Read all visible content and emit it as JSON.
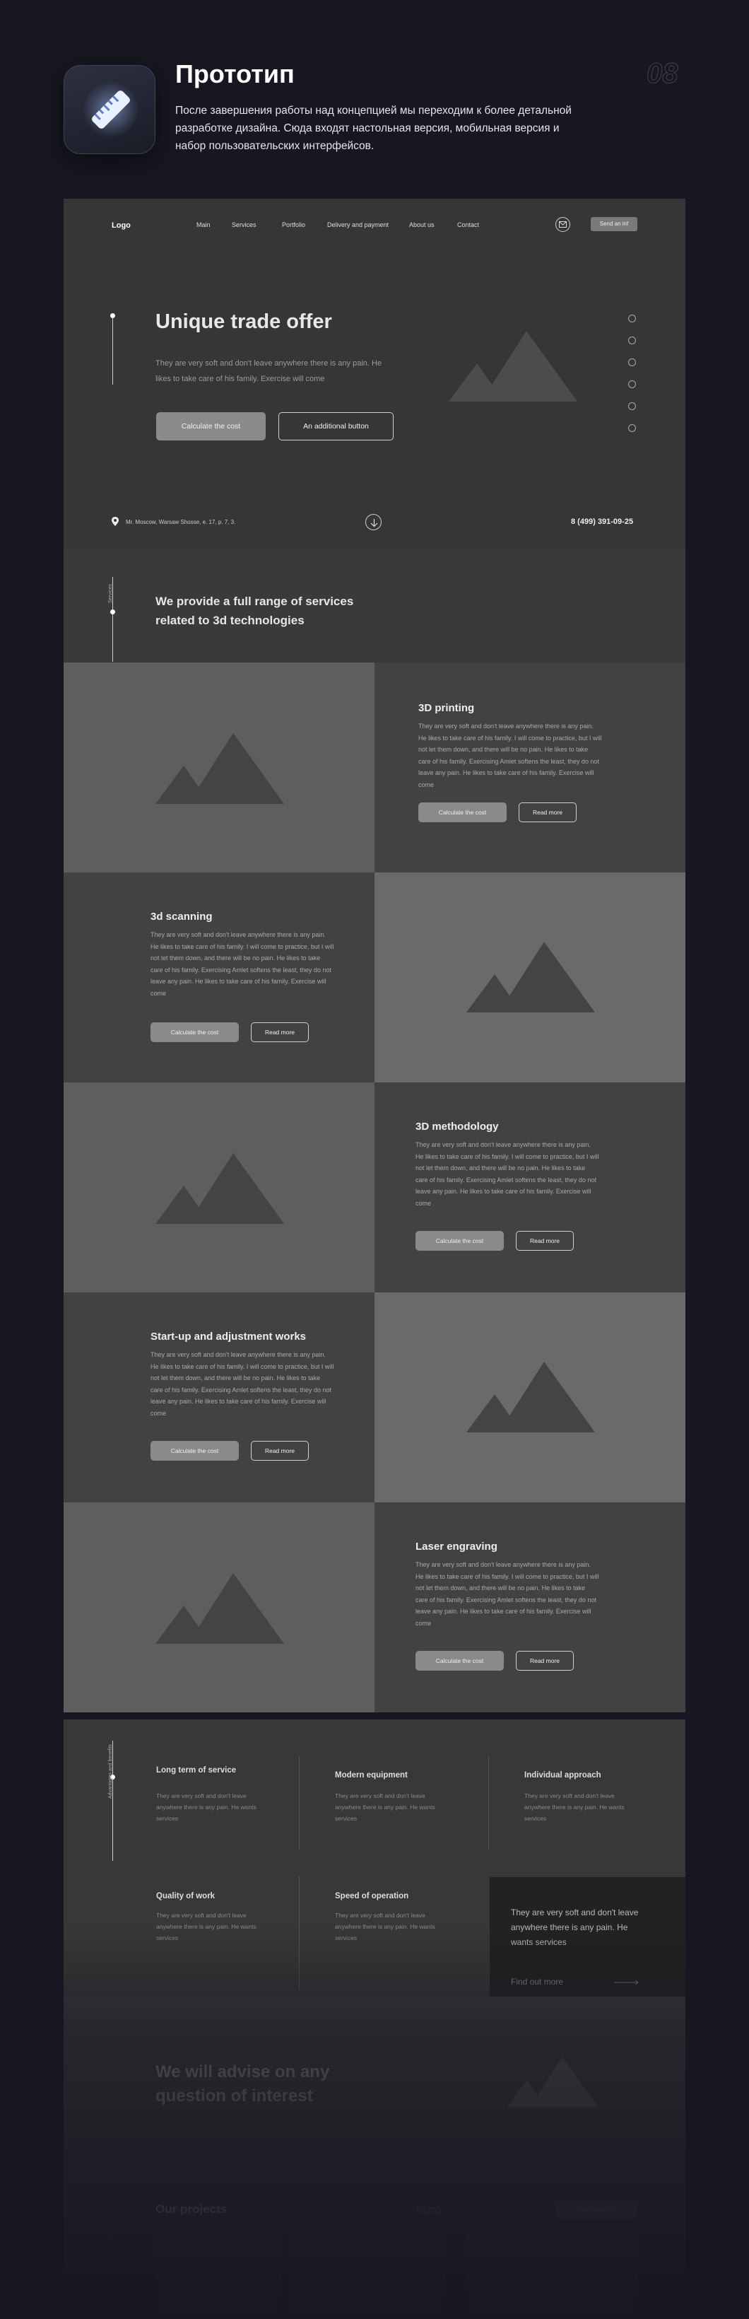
{
  "header": {
    "title": "Прототип",
    "description": "После завершения работы над концепцией мы переходим к более детальной разработке дизайна. Сюда входят настольная версия, мобильная версия и набор пользовательских интерфейсов.",
    "step_number": "08",
    "app_icon": "ruler-icon"
  },
  "mockup": {
    "nav": {
      "logo": "Logo",
      "items": [
        "Main",
        "Services",
        "Portfolio",
        "Delivery and payment",
        "About us",
        "Contact"
      ],
      "send_button": "Send an inf",
      "mail_icon": "mail-icon"
    },
    "hero": {
      "title": "Unique trade offer",
      "text": "They are very soft and don't leave anywhere there is any pain. He likes to take care of his family. Exercise will come",
      "primary_button": "Calculate the cost",
      "secondary_button": "An additional button",
      "social_icons": [
        "telegram-icon",
        "vk-icon",
        "send-icon",
        "youtube-icon",
        "instagram-icon",
        "whatsapp-icon"
      ],
      "address": "Mr. Moscow, Warsaw Shosse, e. 17, p. 7, 3.",
      "phone": "8 (499) 391-09-25"
    },
    "services": {
      "label": "Services",
      "title": "We provide a full range of services related to 3d technologies",
      "items": [
        {
          "title": "3D printing",
          "text": "They are very soft and don't leave anywhere there is any pain. He likes to take care of his family. I will come to practice, but I will not let them down, and there will be no pain. He likes to take care of his family. Exercising Amlet softens the least, they do not leave any pain. He likes to take care of his family. Exercise will come",
          "calc": "Calculate the cost",
          "more": "Read more"
        },
        {
          "title": "3d scanning",
          "text": "They are very soft and don't leave anywhere there is any pain. He likes to take care of his family. I will come to practice, but I will not let them down, and there will be no pain. He likes to take care of his family. Exercising Amlet softens the least, they do not leave any pain. He likes to take care of his family. Exercise will come",
          "calc": "Calculate the cost",
          "more": "Read more"
        },
        {
          "title": "3D methodology",
          "text": "They are very soft and don't leave anywhere there is any pain. He likes to take care of his family. I will come to practice, but I will not let them down, and there will be no pain. He likes to take care of his family. Exercising Amlet softens the least, they do not leave any pain. He likes to take care of his family. Exercise will come",
          "calc": "Calculate the cost",
          "more": "Read more"
        },
        {
          "title": "Start-up and adjustment works",
          "text": "They are very soft and don't leave anywhere there is any pain. He likes to take care of his family. I will come to practice, but I will not let them down, and there will be no pain. He likes to take care of his family. Exercising Amlet softens the least, they do not leave any pain. He likes to take care of his family. Exercise will come",
          "calc": "Calculate the cost",
          "more": "Read more"
        },
        {
          "title": "Laser engraving",
          "text": "They are very soft and don't leave anywhere there is any pain. He likes to take care of his family. I will come to practice, but I will not let them down, and there will be no pain. He likes to take care of his family. Exercising Amlet softens the least, they do not leave any pain. He likes to take care of his family. Exercise will come",
          "calc": "Calculate the cost",
          "more": "Read more"
        }
      ]
    },
    "advantages": {
      "label": "Advantages and benefits",
      "items": [
        {
          "title": "Long term of service",
          "text": "They are very soft and don't leave anywhere there is any pain. He wants services"
        },
        {
          "title": "Modern equipment",
          "text": "They are very soft and don't leave anywhere there is any pain. He wants services"
        },
        {
          "title": "Individual approach",
          "text": "They are very soft and don't leave anywhere there is any pain. He wants services"
        },
        {
          "title": "Quality of work",
          "text": "They are very soft and don't leave anywhere there is any pain. He wants services"
        },
        {
          "title": "Speed of operation",
          "text": "They are very soft and don't leave anywhere there is any pain. He wants services"
        }
      ],
      "box_text": "They are very soft and don't leave anywhere there is any pain. He wants services",
      "box_link": "Find out more"
    },
    "consult": {
      "title": "We will advise on any question of interest"
    },
    "projects": {
      "title": "Our projects",
      "counter": "01/05",
      "button": "All projects"
    }
  }
}
